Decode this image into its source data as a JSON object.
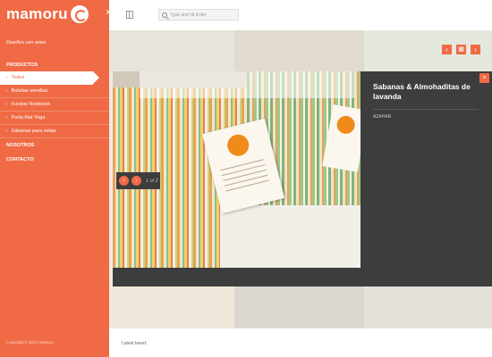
{
  "brand": {
    "name": "mamoru",
    "accent": "#ef6a45"
  },
  "sidebar": {
    "tagline": "Diseños con amor",
    "sections": [
      {
        "label": "PRODUCTOS"
      },
      {
        "label": "NOSOTROS"
      },
      {
        "label": "CONTACTO"
      }
    ],
    "items": [
      {
        "label": "Todos",
        "active": true
      },
      {
        "label": "Bolsitas semillas"
      },
      {
        "label": "Fundas Notebook"
      },
      {
        "label": "Porta Mat Yoga"
      },
      {
        "label": "Sábanas para ositas"
      }
    ],
    "copyright": "Copyright © 2013 mamoru."
  },
  "topbar": {
    "search_placeholder": "Type and hit Enter"
  },
  "lightbox": {
    "title": "Sabanas & Almohaditas de lavanda",
    "category": "AZAHAR",
    "pager_text": "1 of 2",
    "prev_icon": "‹",
    "next_icon": "›",
    "close_icon": "×"
  },
  "gallery_controls": {
    "prev_icon": "‹",
    "grid_icon": "▦",
    "next_icon": "›"
  },
  "footer": {
    "latest_tweet": "Latest tweet:"
  }
}
